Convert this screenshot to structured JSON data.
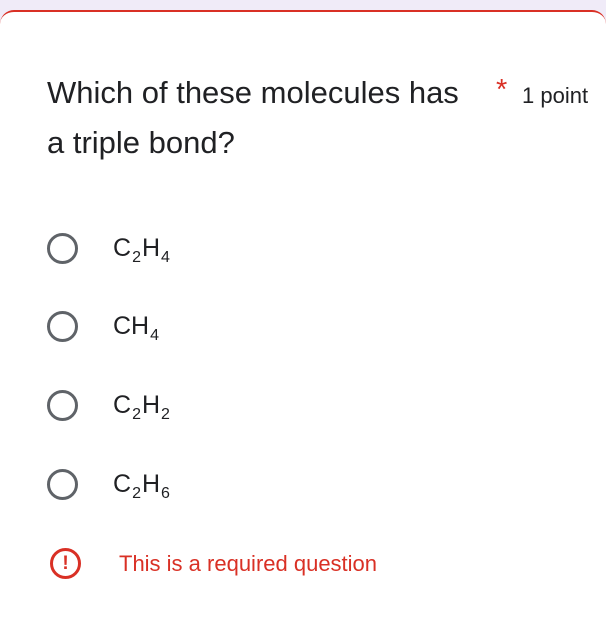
{
  "question": {
    "title": "Which of these molecules has a triple bond?",
    "required_marker": "*",
    "points": "1 point"
  },
  "options": [
    {
      "base1": "C",
      "sub1": "2",
      "base2": "H",
      "sub2": "4"
    },
    {
      "base1": "CH",
      "sub1": "4",
      "base2": "",
      "sub2": ""
    },
    {
      "base1": "C",
      "sub1": "2",
      "base2": "H",
      "sub2": "2"
    },
    {
      "base1": "C",
      "sub1": "2",
      "base2": "H",
      "sub2": "6"
    }
  ],
  "validation": {
    "icon_glyph": "!",
    "message": "This is a required question"
  },
  "colors": {
    "error": "#d93025",
    "radio_border": "#5f6368",
    "text": "#202124"
  }
}
